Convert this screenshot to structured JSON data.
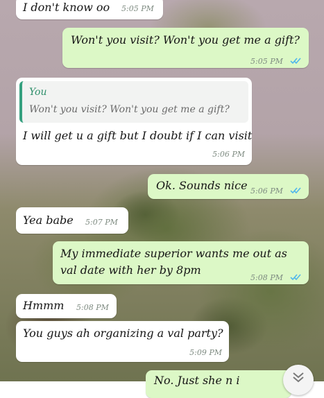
{
  "messages": [
    {
      "text": "I don't know oo",
      "time": "5:05 PM"
    },
    {
      "text": "Won't you visit? Won't you get me a gift?",
      "time": "5:05 PM"
    },
    {
      "quote_author": "You",
      "quote_text": "Won't you visit? Won't you get me a gift?",
      "text": "I will get u a gift but I doubt if I can visit",
      "time": "5:06 PM"
    },
    {
      "text": "Ok. Sounds nice",
      "time": "5:06 PM"
    },
    {
      "text": "Yea babe",
      "time": "5:07 PM"
    },
    {
      "text": "My immediate superior wants me out as",
      "text2": "val date with her by 8pm",
      "time": "5:08 PM"
    },
    {
      "text": "Hmmm",
      "time": "5:08 PM"
    },
    {
      "text": "You guys ah organizing a val party?",
      "time": "5:09 PM"
    },
    {
      "text": "No. Just she n i"
    }
  ],
  "colors": {
    "outgoing": "#dcf8c6",
    "incoming": "#ffffff",
    "read_ticks": "#4fb6ec"
  },
  "icons": {
    "read_receipt": "double-check-icon",
    "scroll": "chevron-down-icon"
  }
}
